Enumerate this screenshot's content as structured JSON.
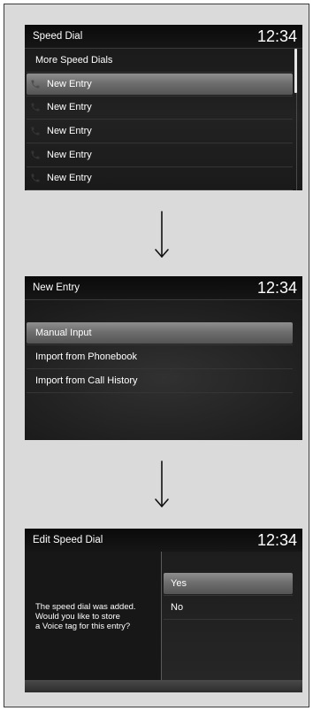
{
  "colors": {
    "page_background": "#dadada",
    "frame_border": "#3c3c3c",
    "screen_background": "#1c1c1c",
    "highlight": "#6e6e6e",
    "text": "#ffffff",
    "arrow": "#111111"
  },
  "speed_dial_screen": {
    "title": "Speed Dial",
    "clock": "12:34",
    "items": [
      {
        "label": "More Speed Dials"
      },
      {
        "label": "New Entry",
        "icon": "phone-icon",
        "selected": true
      },
      {
        "label": "New Entry",
        "icon": "phone-icon"
      },
      {
        "label": "New Entry",
        "icon": "phone-icon"
      },
      {
        "label": "New Entry",
        "icon": "phone-icon"
      },
      {
        "label": "New Entry",
        "icon": "phone-icon"
      }
    ]
  },
  "flow_arrow_icon": "down-arrow-icon",
  "new_entry_screen": {
    "title": "New Entry",
    "clock": "12:34",
    "items": [
      {
        "label": "Manual Input",
        "selected": true
      },
      {
        "label": "Import from Phonebook"
      },
      {
        "label": "Import from Call History"
      }
    ]
  },
  "edit_speed_dial_screen": {
    "title": "Edit Speed Dial",
    "clock": "12:34",
    "message_lines": [
      "The speed dial was added.",
      "Would you like to store",
      "a Voice tag for this entry?"
    ],
    "options": [
      {
        "label": "Yes",
        "selected": true
      },
      {
        "label": "No"
      }
    ]
  }
}
